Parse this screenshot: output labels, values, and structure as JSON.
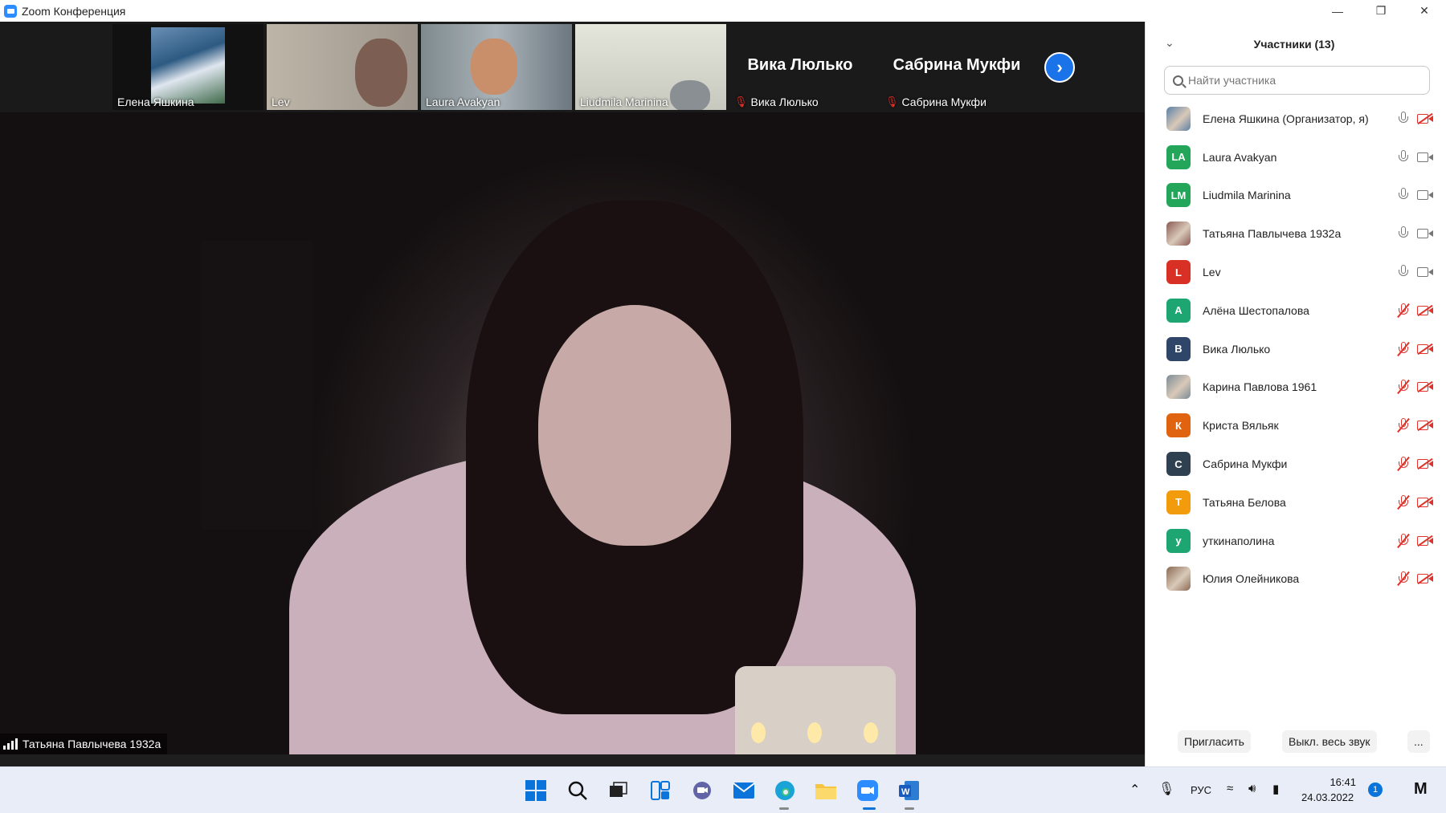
{
  "window": {
    "title": "Zoom Конференция"
  },
  "thumbnails": [
    {
      "name": "Елена Яшкина",
      "type": "video-landscape"
    },
    {
      "name": "Lev",
      "type": "video"
    },
    {
      "name": "Laura Avakyan",
      "type": "video"
    },
    {
      "name": "Liudmila Marinina",
      "type": "video"
    },
    {
      "name": "Вика Люлько",
      "display_name": "Вика Люлько",
      "muted": true
    },
    {
      "name": "Сабрина Мукфи",
      "display_name": "Сабрина Мукфи",
      "muted": true
    }
  ],
  "speaker": {
    "name": "Татьяна Павлычева 1932a"
  },
  "panel": {
    "title": "Участники (13)",
    "search_placeholder": "Найти участника",
    "invite_label": "Пригласить",
    "mute_all_label": "Выкл. весь звук",
    "more_label": "...",
    "participants": [
      {
        "name": "Елена Яшкина (Организатор, я)",
        "initials": "",
        "color": "#5a7fa6",
        "photo": true,
        "mic_on": true,
        "cam_on": false
      },
      {
        "name": "Laura Avakyan",
        "initials": "LA",
        "color": "#23a55a",
        "photo": false,
        "mic_on": true,
        "cam_on": true
      },
      {
        "name": "Liudmila Marinina",
        "initials": "LM",
        "color": "#23a55a",
        "photo": false,
        "mic_on": true,
        "cam_on": true
      },
      {
        "name": "Татьяна Павлычева 1932a",
        "initials": "",
        "color": "#8a5a55",
        "photo": true,
        "mic_on": true,
        "cam_on": true
      },
      {
        "name": "Lev",
        "initials": "L",
        "color": "#d93025",
        "photo": false,
        "mic_on": true,
        "cam_on": true
      },
      {
        "name": "Алёна Шестопалова",
        "initials": "А",
        "color": "#1ea672",
        "photo": false,
        "mic_on": false,
        "cam_on": false
      },
      {
        "name": "Вика Люлько",
        "initials": "В",
        "color": "#2f4668",
        "photo": false,
        "mic_on": false,
        "cam_on": false
      },
      {
        "name": "Карина Павлова 1961",
        "initials": "",
        "color": "#7a8b95",
        "photo": true,
        "mic_on": false,
        "cam_on": false
      },
      {
        "name": "Криста Вяльяк",
        "initials": "К",
        "color": "#e0640f",
        "photo": false,
        "mic_on": false,
        "cam_on": false
      },
      {
        "name": "Сабрина Мукфи",
        "initials": "С",
        "color": "#2f4050",
        "photo": false,
        "mic_on": false,
        "cam_on": false
      },
      {
        "name": "Татьяна Белова",
        "initials": "Т",
        "color": "#f29b0c",
        "photo": false,
        "mic_on": false,
        "cam_on": false
      },
      {
        "name": "уткинаполина",
        "initials": "у",
        "color": "#1ea672",
        "photo": false,
        "mic_on": false,
        "cam_on": false
      },
      {
        "name": "Юлия Олейникова",
        "initials": "",
        "color": "#8a6a55",
        "photo": true,
        "mic_on": false,
        "cam_on": false
      }
    ]
  },
  "taskbar": {
    "language": "РУС",
    "time": "16:41",
    "date": "24.03.2022",
    "notification_count": "1"
  }
}
